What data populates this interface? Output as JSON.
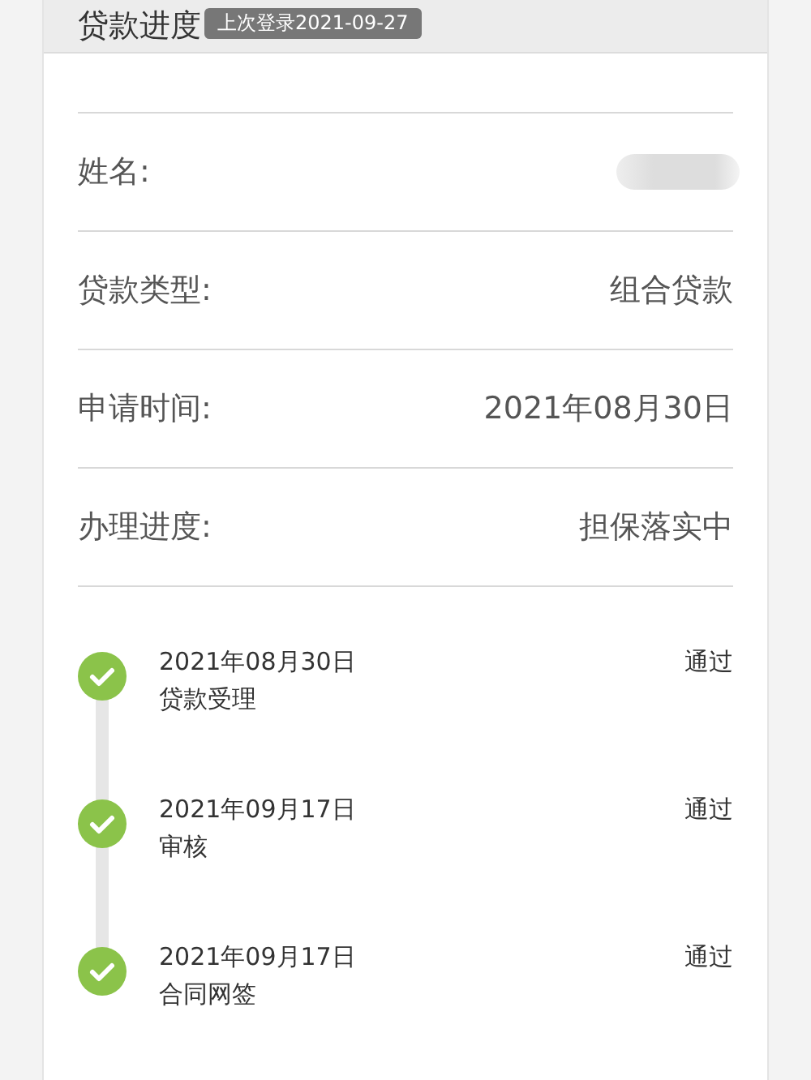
{
  "header": {
    "title": "贷款进度",
    "badge": "上次登录2021-09-27"
  },
  "fields": [
    {
      "label": "姓名:",
      "value_redacted": true
    },
    {
      "label": "贷款类型:",
      "value": "组合贷款"
    },
    {
      "label": "申请时间:",
      "value": "2021年08月30日"
    },
    {
      "label": "办理进度:",
      "value": "担保落实中"
    }
  ],
  "timeline": [
    {
      "date": "2021年08月30日",
      "step": "贷款受理",
      "status": "通过",
      "done": true
    },
    {
      "date": "2021年09月17日",
      "step": "审核",
      "status": "通过",
      "done": true
    },
    {
      "date": "2021年09月17日",
      "step": "合同网签",
      "status": "通过",
      "done": true
    }
  ]
}
